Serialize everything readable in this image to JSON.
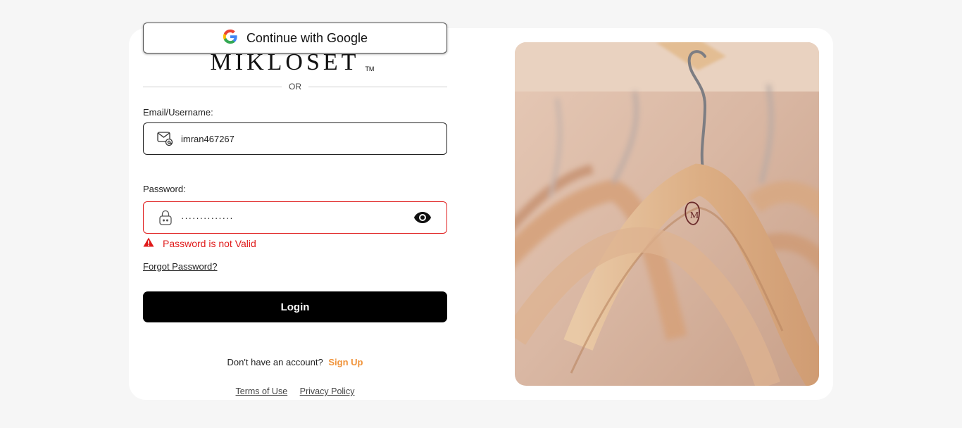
{
  "google_button": {
    "label": "Continue with Google",
    "icon": "google-g-icon"
  },
  "logo": {
    "text": "MIKLOSET",
    "trademark": "TM"
  },
  "divider": {
    "text": "OR"
  },
  "email": {
    "label": "Email/Username:",
    "value": "imran467267",
    "icon": "mail-at-icon"
  },
  "password": {
    "label": "Password:",
    "value": "··············",
    "icon": "lock-icon",
    "toggle_icon": "eye-icon"
  },
  "error": {
    "text": "Password is not Valid",
    "icon": "warning-triangle-icon",
    "color": "#e01a1a"
  },
  "forgot": {
    "text": "Forgot Password?"
  },
  "login": {
    "label": "Login"
  },
  "signup": {
    "prompt": "Don't have an account?",
    "link": "Sign Up",
    "link_color": "#f0933a"
  },
  "footer": {
    "terms": "Terms of Use",
    "privacy": "Privacy Policy"
  },
  "hero_image": {
    "description_icon": "clothes-hanger-photo",
    "brand_mark": "M"
  },
  "colors": {
    "page_bg": "#f6f6f6",
    "card_bg": "#ffffff",
    "button_bg": "#000000",
    "error_border": "#e02020"
  }
}
